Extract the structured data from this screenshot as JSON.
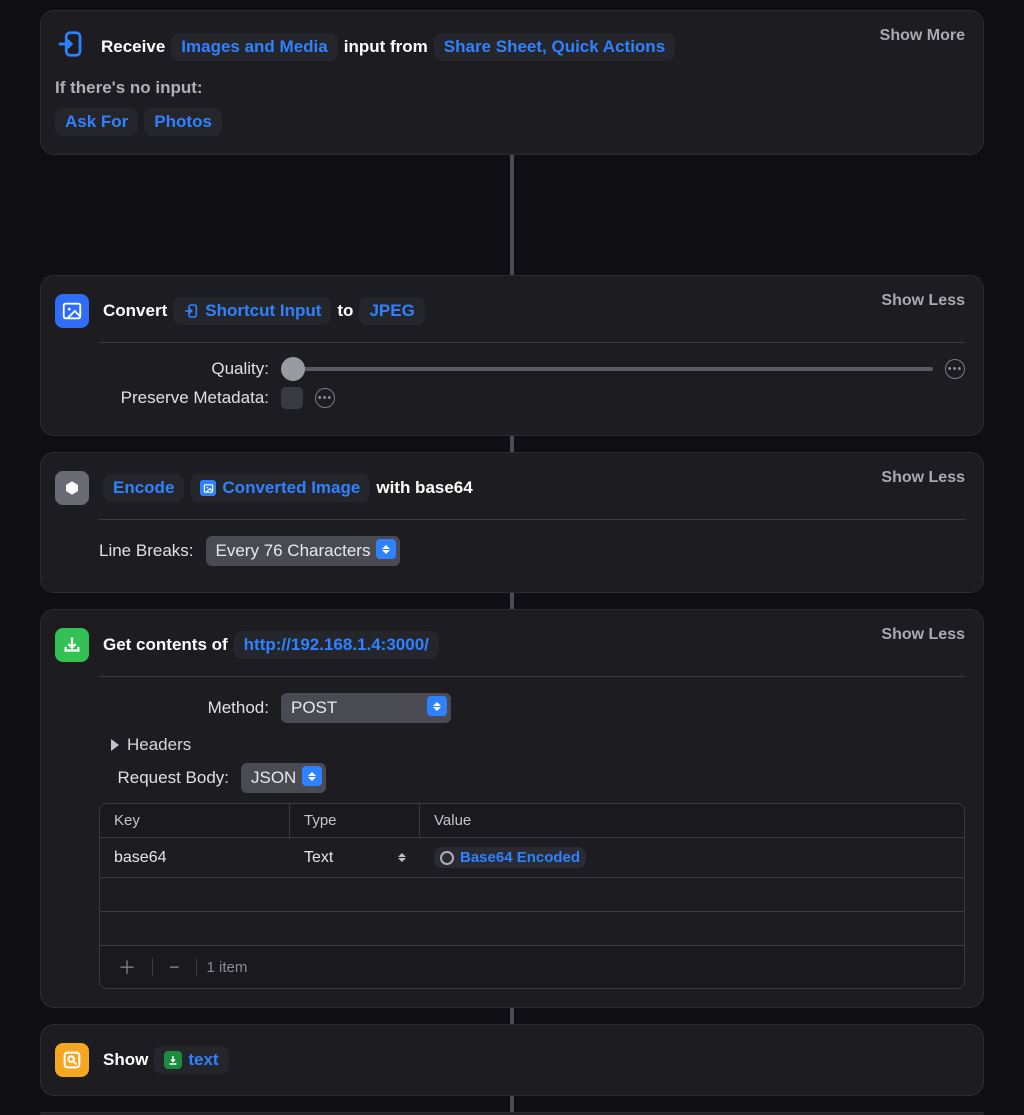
{
  "receive": {
    "verb": "Receive",
    "type_token": "Images and Media",
    "mid": "input from",
    "source_token": "Share Sheet, Quick Actions",
    "toggle": "Show More",
    "no_input_label": "If there's no input:",
    "fallback_action": "Ask For",
    "fallback_type": "Photos"
  },
  "convert": {
    "verb": "Convert",
    "input_token": "Shortcut Input",
    "to": "to",
    "format_token": "JPEG",
    "toggle": "Show Less",
    "quality_label": "Quality:",
    "preserve_label": "Preserve Metadata:"
  },
  "encode": {
    "verb": "Encode",
    "input_token": "Converted Image",
    "with": "with base64",
    "toggle": "Show Less",
    "line_breaks_label": "Line Breaks:",
    "line_breaks_value": "Every 76 Characters"
  },
  "get": {
    "verb": "Get contents of",
    "url_token": "http://192.168.1.4:3000/",
    "toggle": "Show Less",
    "method_label": "Method:",
    "method_value": "POST",
    "headers_label": "Headers",
    "body_label": "Request Body:",
    "body_value": "JSON",
    "table": {
      "cols": {
        "key": "Key",
        "type": "Type",
        "value": "Value"
      },
      "rows": [
        {
          "key": "base64",
          "type": "Text",
          "value_token": "Base64 Encoded"
        }
      ],
      "item_count": "1 item"
    }
  },
  "show": {
    "verb": "Show",
    "input_token": "text"
  }
}
